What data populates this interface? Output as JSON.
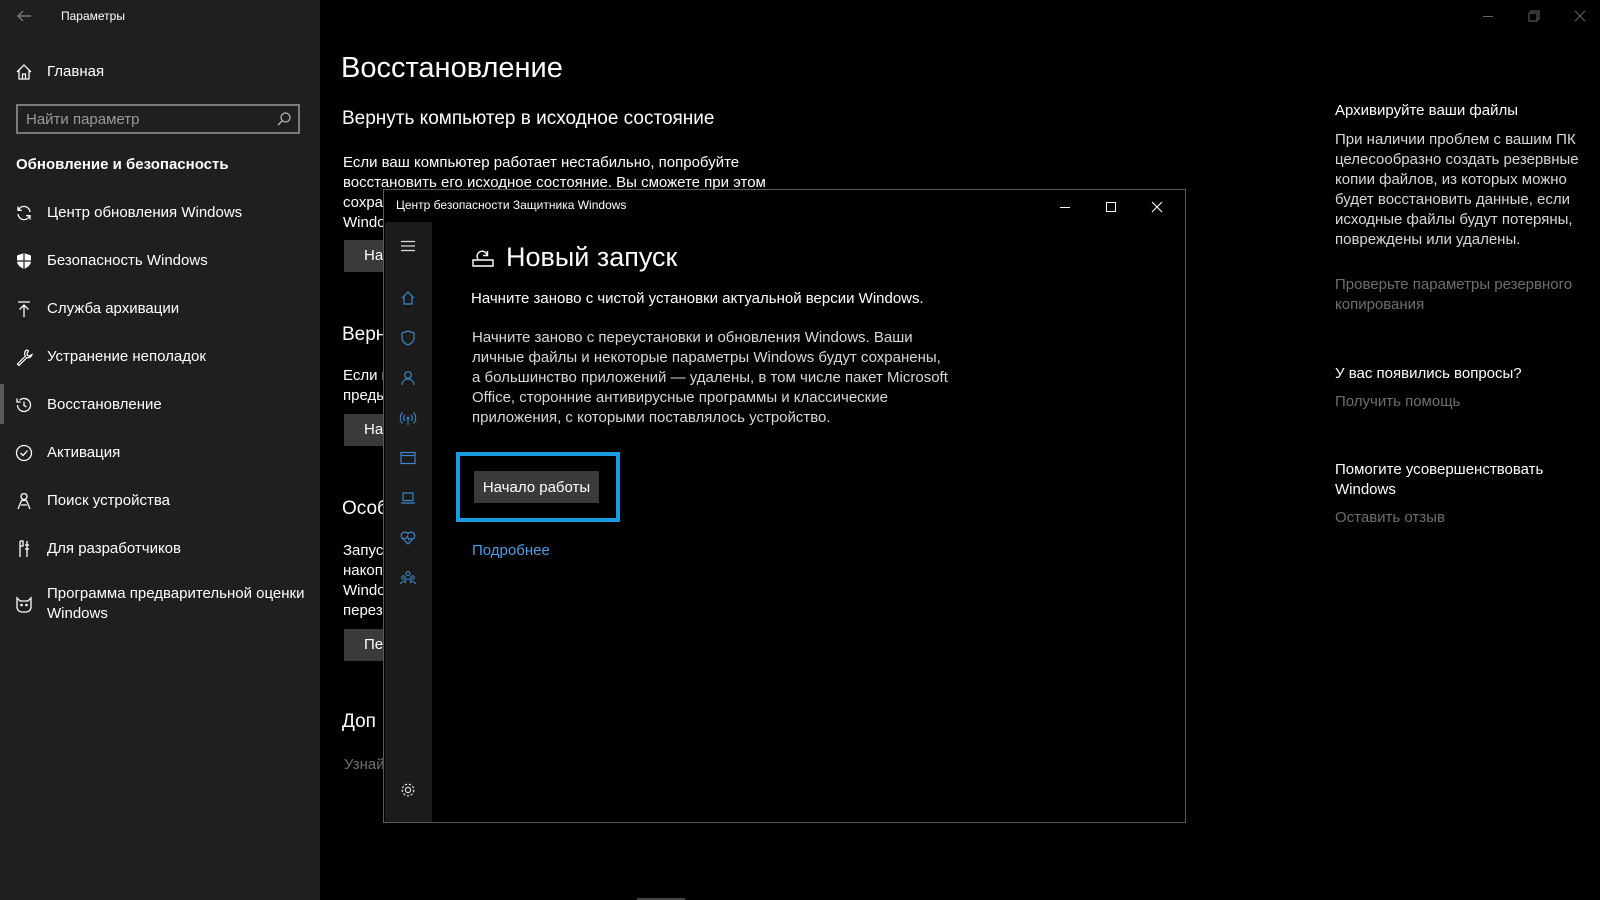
{
  "settings": {
    "window_title": "Параметры",
    "sidebar": {
      "home_label": "Главная",
      "search_placeholder": "Найти параметр",
      "section_title": "Обновление и безопасность",
      "items": [
        {
          "label": "Центр обновления Windows",
          "icon": "refresh-icon"
        },
        {
          "label": "Безопасность Windows",
          "icon": "shield-icon"
        },
        {
          "label": "Служба архивации",
          "icon": "upload-arrow-icon"
        },
        {
          "label": "Устранение неполадок",
          "icon": "wrench-icon"
        },
        {
          "label": "Восстановление",
          "icon": "history-icon",
          "selected": true
        },
        {
          "label": "Активация",
          "icon": "check-circle-icon"
        },
        {
          "label": "Поиск устройства",
          "icon": "person-location-icon"
        },
        {
          "label": "Для разработчиков",
          "icon": "developer-tools-icon"
        },
        {
          "label": "Программа предварительной оценки Windows",
          "icon": "insider-cat-icon"
        }
      ]
    },
    "main": {
      "title": "Восстановление",
      "reset_heading": "Вернуть компьютер в исходное состояние",
      "reset_text_line1": "Если ваш компьютер работает нестабильно, попробуйте",
      "reset_text_line2": "восстановить его исходное состояние. Вы сможете при этом",
      "reset_text_line3": "сохра",
      "reset_text_line4": "Windo",
      "reset_button": "На",
      "back_heading": "Верн",
      "back_text_line1": "Если в",
      "back_text_line2": "преды",
      "back_button": "На",
      "advanced_heading": "Особ",
      "advanced_text_line1": "Запус",
      "advanced_text_line2": "накоп",
      "advanced_text_line3": "Windo",
      "advanced_text_line4": "перез",
      "advanced_button": "Пер",
      "more_heading": "Доп",
      "more_link": "Узнай"
    },
    "right": {
      "backup_heading": "Архивируйте ваши файлы",
      "backup_text": "При наличии проблем с вашим ПК целесообразно создать резервные копии файлов, из которых можно будет восстановить данные, если исходные файлы будут потеряны, повреждены или удалены.",
      "backup_link": "Проверьте параметры резервного копирования",
      "questions_heading": "У вас появились вопросы?",
      "questions_link": "Получить помощь",
      "feedback_heading": "Помогите усовершенствовать Windows",
      "feedback_link": "Оставить отзыв"
    }
  },
  "dialog": {
    "title": "Центр безопасности Защитника Windows",
    "heading": "Новый запуск",
    "subtitle": "Начните заново с чистой установки актуальной версии Windows.",
    "paragraph": "Начните заново с переустановки и обновления Windows. Ваши личные файлы и некоторые параметры Windows будут сохранены, а большинство приложений — удалены, в том числе пакет Microsoft Office, сторонние антивирусные программы и классические приложения, с которыми поставлялось устройство.",
    "start_button": "Начало работы",
    "more_link": "Подробнее",
    "nav_icons": [
      "home-icon",
      "shield-icon",
      "person-icon",
      "wireless-icon",
      "browser-icon",
      "laptop-icon",
      "heart-icon",
      "family-icon",
      "gear-icon"
    ]
  },
  "colors": {
    "sidebar_bg": "#1f1f1f",
    "accent_highlight": "#1b9be0",
    "link_blue": "#4a9ee8",
    "muted_link": "#6e6e6e"
  }
}
